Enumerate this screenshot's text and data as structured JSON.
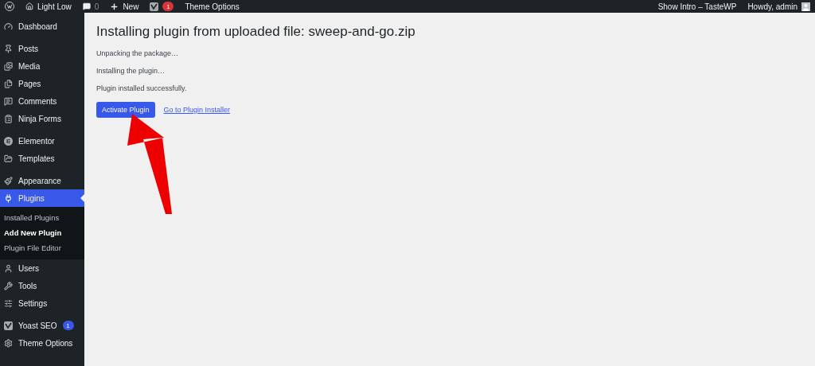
{
  "admin_bar": {
    "site": "Light Low",
    "comments": "0",
    "new": "New",
    "yoast_badge": "1",
    "theme_options": "Theme Options",
    "show_intro": "Show Intro – TasteWP",
    "howdy": "Howdy, admin"
  },
  "sidebar": {
    "groups": [
      [
        {
          "label": "Dashboard",
          "selected": false
        }
      ],
      [
        {
          "label": "Posts",
          "selected": false
        },
        {
          "label": "Media",
          "selected": false
        },
        {
          "label": "Pages",
          "selected": false
        },
        {
          "label": "Comments",
          "selected": false
        },
        {
          "label": "Ninja Forms",
          "selected": false
        }
      ],
      [
        {
          "label": "Elementor",
          "selected": false
        },
        {
          "label": "Templates",
          "selected": false
        }
      ],
      [
        {
          "label": "Appearance",
          "selected": false
        },
        {
          "label": "Plugins",
          "selected": true,
          "submenu": [
            {
              "label": "Installed Plugins",
              "selected": false
            },
            {
              "label": "Add New Plugin",
              "selected": true
            },
            {
              "label": "Plugin File Editor",
              "selected": false
            }
          ]
        },
        {
          "label": "Users",
          "selected": false
        },
        {
          "label": "Tools",
          "selected": false
        },
        {
          "label": "Settings",
          "selected": false
        }
      ],
      [
        {
          "label": "Yoast SEO",
          "selected": false,
          "badge": "1"
        },
        {
          "label": "Theme Options",
          "selected": false
        }
      ]
    ]
  },
  "content": {
    "title": "Installing plugin from uploaded file: sweep-and-go.zip",
    "messages": [
      "Unpacking the package…",
      "Installing the plugin…",
      "Plugin installed successfully."
    ],
    "primary_button": "Activate Plugin",
    "link": "Go to Plugin Installer"
  }
}
